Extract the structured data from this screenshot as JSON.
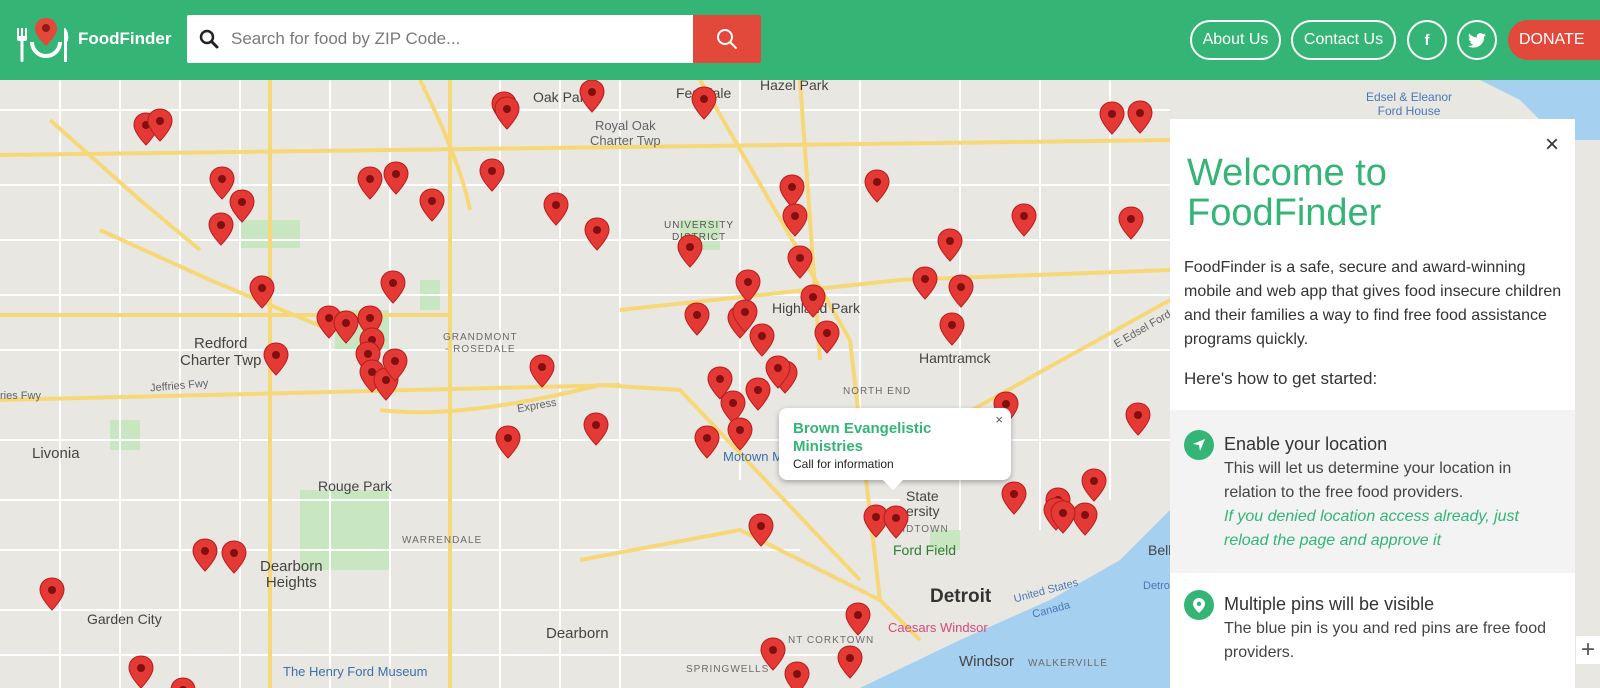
{
  "header": {
    "logo_text": "FoodFinder",
    "search_placeholder": "Search for food by ZIP Code...",
    "nav": {
      "about": "About Us",
      "contact": "Contact Us",
      "facebook": "f",
      "donate": "DONATE"
    }
  },
  "map": {
    "labels": {
      "oak_park": "Oak Park",
      "ferndale": "Ferndale",
      "hazel_park": "Hazel Park",
      "royal_oak": "Royal Oak\nCharter Twp",
      "edsel": "Edsel & Eleanor\nFord House",
      "university": "UNIVERSITY\nDISTRICT",
      "highland_park": "Highland Park",
      "redford": "Redford\nCharter Twp",
      "grandmont": "GRANDMONT\n- ROSEDALE",
      "hamtramck": "Hamtramck",
      "north_end": "NORTH END",
      "jeffries": "Jeffries Fwy",
      "jeffries_left": "ries Fwy",
      "express": "Express",
      "livonia": "Livonia",
      "rouge_park": "Rouge Park",
      "motown": "Motown M",
      "state_u": "State\nersity",
      "warrendale": "WARRENDALE",
      "midtown": "MIDTOWN",
      "ford_field": "Ford Field",
      "dearborn_heights": "Dearborn\nHeights",
      "detroit": "Detroit",
      "garden_city": "Garden City",
      "dearborn": "Dearborn",
      "caesars": "Caesars Windsor",
      "windsor": "Windsor",
      "walkerville": "WALKERVILLE",
      "united_states": "United States",
      "canada": "Canada",
      "henry_ford": "The Henry Ford Museum",
      "springwells": "SPRINGWELLS",
      "e_edsel": "E Edsel Ford Fr",
      "bell": "Bell",
      "detro": "Detro",
      "corktown": "NT CORKTOWN"
    }
  },
  "popup": {
    "title": "Brown Evangelistic Ministries",
    "subtitle": "Call for information",
    "close": "×"
  },
  "panel": {
    "close": "×",
    "title": "Welcome to FoodFinder",
    "intro": "FoodFinder is a safe, secure and award-winning mobile and web app that gives food insecure children and their families a way to find free food assistance programs quickly.",
    "how": "Here's how to get started:",
    "steps": [
      {
        "title": "Enable your location",
        "desc": "This will let us determine your location in relation to the free food providers.",
        "note": "If you denied location access already, just reload the page and approve it"
      },
      {
        "title": "Multiple pins will be visible",
        "desc": "The blue pin is you and red pins are free food providers."
      }
    ]
  },
  "zoom_plus": "+",
  "colors": {
    "brand_green": "#34b576",
    "accent_red": "#e3493b",
    "pin_red": "#e53935"
  }
}
